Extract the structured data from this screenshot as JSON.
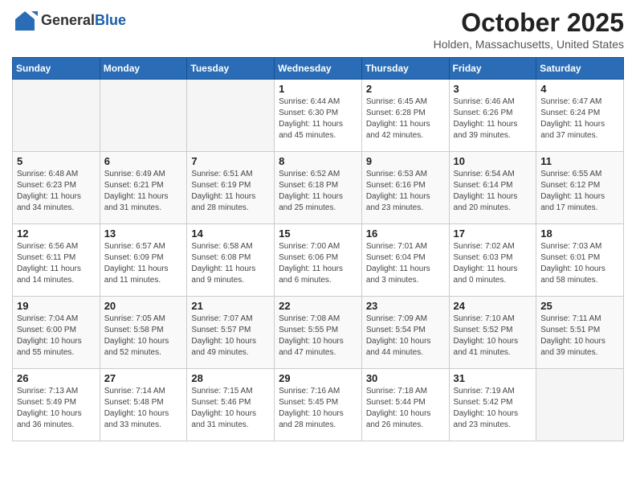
{
  "header": {
    "logo_general": "General",
    "logo_blue": "Blue",
    "month": "October 2025",
    "location": "Holden, Massachusetts, United States"
  },
  "weekdays": [
    "Sunday",
    "Monday",
    "Tuesday",
    "Wednesday",
    "Thursday",
    "Friday",
    "Saturday"
  ],
  "weeks": [
    [
      {
        "day": "",
        "info": ""
      },
      {
        "day": "",
        "info": ""
      },
      {
        "day": "",
        "info": ""
      },
      {
        "day": "1",
        "info": "Sunrise: 6:44 AM\nSunset: 6:30 PM\nDaylight: 11 hours\nand 45 minutes."
      },
      {
        "day": "2",
        "info": "Sunrise: 6:45 AM\nSunset: 6:28 PM\nDaylight: 11 hours\nand 42 minutes."
      },
      {
        "day": "3",
        "info": "Sunrise: 6:46 AM\nSunset: 6:26 PM\nDaylight: 11 hours\nand 39 minutes."
      },
      {
        "day": "4",
        "info": "Sunrise: 6:47 AM\nSunset: 6:24 PM\nDaylight: 11 hours\nand 37 minutes."
      }
    ],
    [
      {
        "day": "5",
        "info": "Sunrise: 6:48 AM\nSunset: 6:23 PM\nDaylight: 11 hours\nand 34 minutes."
      },
      {
        "day": "6",
        "info": "Sunrise: 6:49 AM\nSunset: 6:21 PM\nDaylight: 11 hours\nand 31 minutes."
      },
      {
        "day": "7",
        "info": "Sunrise: 6:51 AM\nSunset: 6:19 PM\nDaylight: 11 hours\nand 28 minutes."
      },
      {
        "day": "8",
        "info": "Sunrise: 6:52 AM\nSunset: 6:18 PM\nDaylight: 11 hours\nand 25 minutes."
      },
      {
        "day": "9",
        "info": "Sunrise: 6:53 AM\nSunset: 6:16 PM\nDaylight: 11 hours\nand 23 minutes."
      },
      {
        "day": "10",
        "info": "Sunrise: 6:54 AM\nSunset: 6:14 PM\nDaylight: 11 hours\nand 20 minutes."
      },
      {
        "day": "11",
        "info": "Sunrise: 6:55 AM\nSunset: 6:12 PM\nDaylight: 11 hours\nand 17 minutes."
      }
    ],
    [
      {
        "day": "12",
        "info": "Sunrise: 6:56 AM\nSunset: 6:11 PM\nDaylight: 11 hours\nand 14 minutes."
      },
      {
        "day": "13",
        "info": "Sunrise: 6:57 AM\nSunset: 6:09 PM\nDaylight: 11 hours\nand 11 minutes."
      },
      {
        "day": "14",
        "info": "Sunrise: 6:58 AM\nSunset: 6:08 PM\nDaylight: 11 hours\nand 9 minutes."
      },
      {
        "day": "15",
        "info": "Sunrise: 7:00 AM\nSunset: 6:06 PM\nDaylight: 11 hours\nand 6 minutes."
      },
      {
        "day": "16",
        "info": "Sunrise: 7:01 AM\nSunset: 6:04 PM\nDaylight: 11 hours\nand 3 minutes."
      },
      {
        "day": "17",
        "info": "Sunrise: 7:02 AM\nSunset: 6:03 PM\nDaylight: 11 hours\nand 0 minutes."
      },
      {
        "day": "18",
        "info": "Sunrise: 7:03 AM\nSunset: 6:01 PM\nDaylight: 10 hours\nand 58 minutes."
      }
    ],
    [
      {
        "day": "19",
        "info": "Sunrise: 7:04 AM\nSunset: 6:00 PM\nDaylight: 10 hours\nand 55 minutes."
      },
      {
        "day": "20",
        "info": "Sunrise: 7:05 AM\nSunset: 5:58 PM\nDaylight: 10 hours\nand 52 minutes."
      },
      {
        "day": "21",
        "info": "Sunrise: 7:07 AM\nSunset: 5:57 PM\nDaylight: 10 hours\nand 49 minutes."
      },
      {
        "day": "22",
        "info": "Sunrise: 7:08 AM\nSunset: 5:55 PM\nDaylight: 10 hours\nand 47 minutes."
      },
      {
        "day": "23",
        "info": "Sunrise: 7:09 AM\nSunset: 5:54 PM\nDaylight: 10 hours\nand 44 minutes."
      },
      {
        "day": "24",
        "info": "Sunrise: 7:10 AM\nSunset: 5:52 PM\nDaylight: 10 hours\nand 41 minutes."
      },
      {
        "day": "25",
        "info": "Sunrise: 7:11 AM\nSunset: 5:51 PM\nDaylight: 10 hours\nand 39 minutes."
      }
    ],
    [
      {
        "day": "26",
        "info": "Sunrise: 7:13 AM\nSunset: 5:49 PM\nDaylight: 10 hours\nand 36 minutes."
      },
      {
        "day": "27",
        "info": "Sunrise: 7:14 AM\nSunset: 5:48 PM\nDaylight: 10 hours\nand 33 minutes."
      },
      {
        "day": "28",
        "info": "Sunrise: 7:15 AM\nSunset: 5:46 PM\nDaylight: 10 hours\nand 31 minutes."
      },
      {
        "day": "29",
        "info": "Sunrise: 7:16 AM\nSunset: 5:45 PM\nDaylight: 10 hours\nand 28 minutes."
      },
      {
        "day": "30",
        "info": "Sunrise: 7:18 AM\nSunset: 5:44 PM\nDaylight: 10 hours\nand 26 minutes."
      },
      {
        "day": "31",
        "info": "Sunrise: 7:19 AM\nSunset: 5:42 PM\nDaylight: 10 hours\nand 23 minutes."
      },
      {
        "day": "",
        "info": ""
      }
    ]
  ]
}
